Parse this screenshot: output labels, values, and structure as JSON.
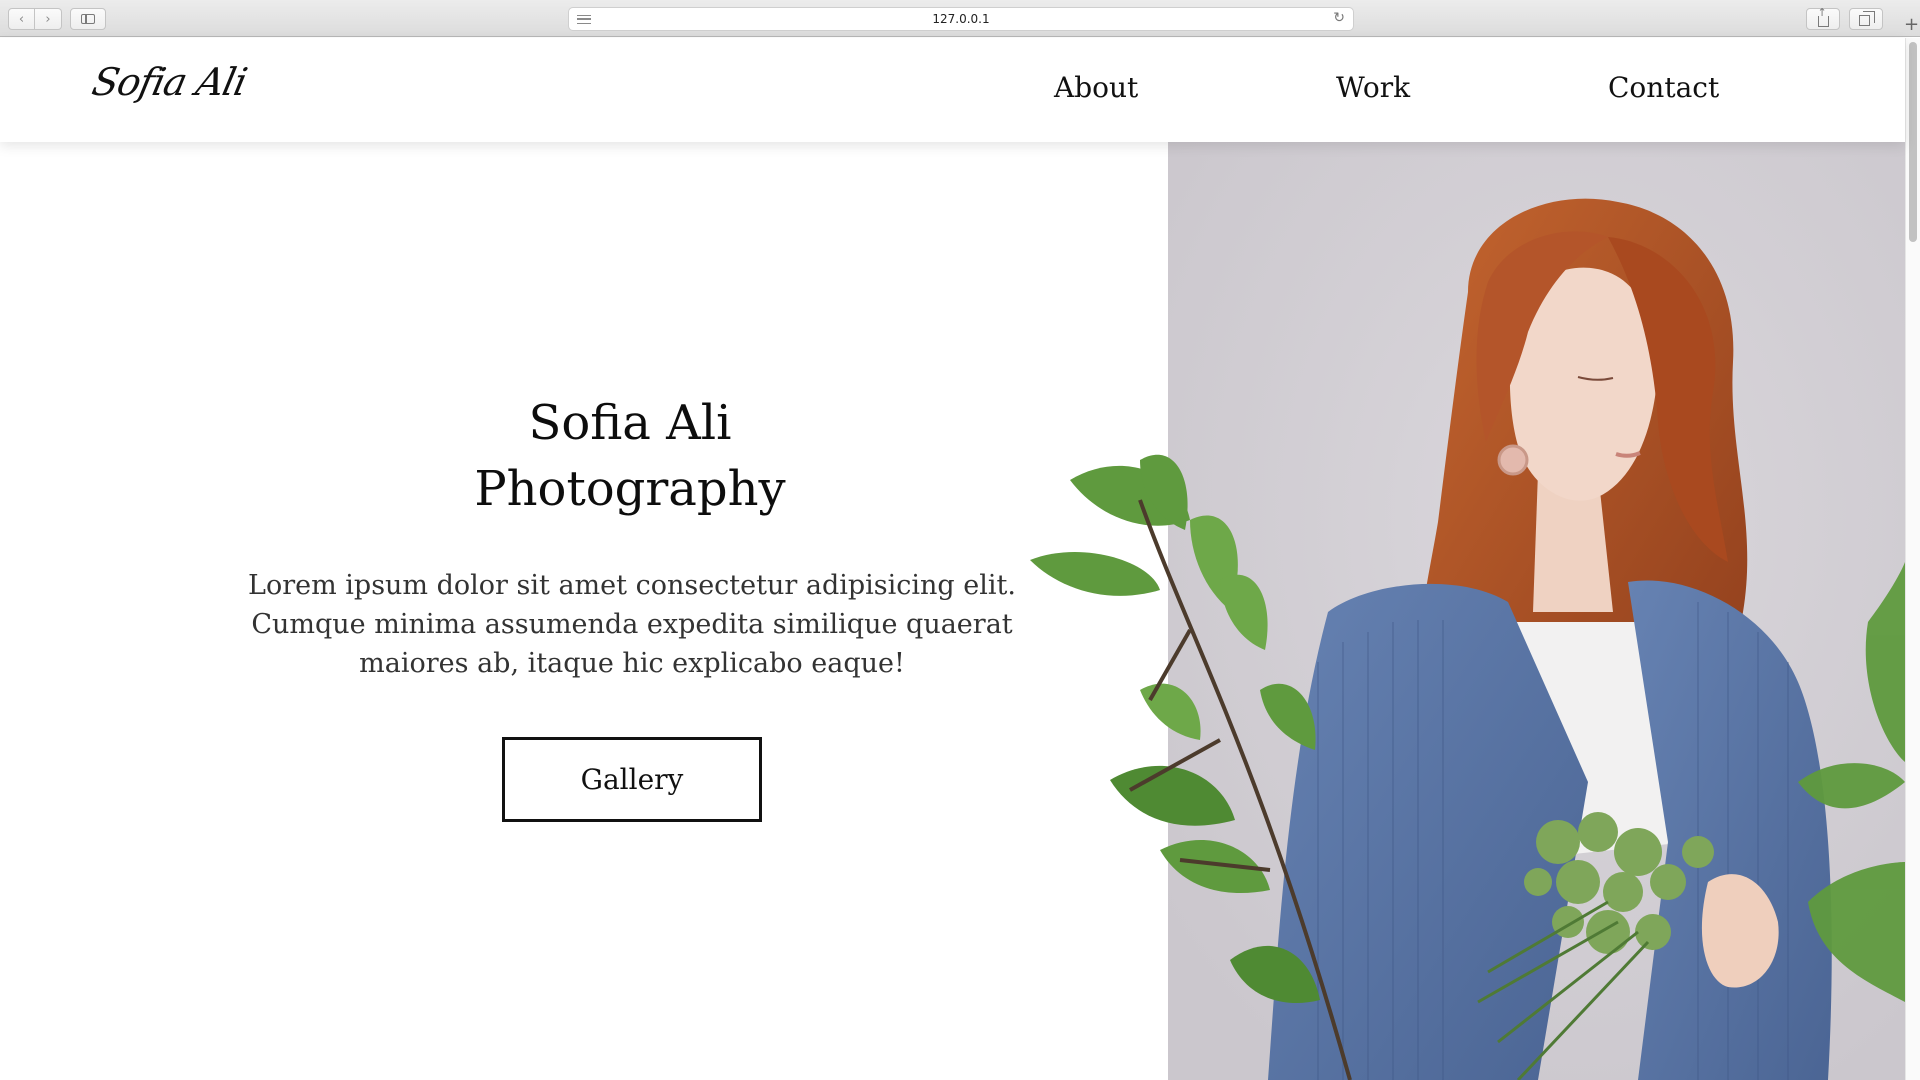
{
  "browser": {
    "url": "127.0.0.1",
    "reload_glyph": "↻",
    "new_tab_glyph": "+"
  },
  "site": {
    "logo": "Sofia Ali",
    "nav": {
      "about": "About",
      "work": "Work",
      "contact": "Contact"
    }
  },
  "hero": {
    "title_line1": "Sofia Ali",
    "title_line2": "Photography",
    "text": "Lorem ipsum dolor sit amet consectetur adipisicing elit. Cumque minima assumenda expedita similique quaerat maiores ab, itaque hic explicabo eaque!",
    "gallery_button": "Gallery"
  },
  "icons": {
    "back": "chevron-left-icon",
    "forward": "chevron-right-icon",
    "sidebar": "sidebar-icon",
    "reader": "reader-icon",
    "reload": "reload-icon",
    "share": "share-icon",
    "tabs": "tabs-icon",
    "new_tab": "plus-icon"
  },
  "colors": {
    "photo_background": "#d3d0d6",
    "hair": "#b5582a",
    "cardigan": "#5a78a8",
    "leaves": "#5f9a3e",
    "text": "#111111"
  }
}
